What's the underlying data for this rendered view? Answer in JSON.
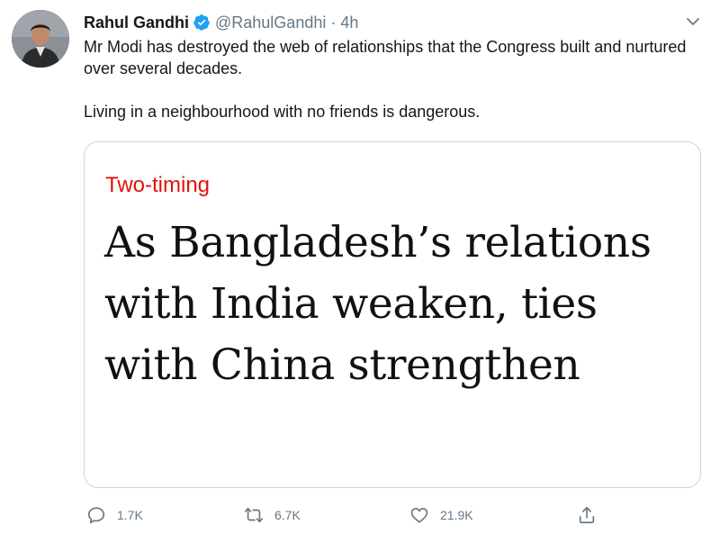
{
  "tweet": {
    "author_name": "Rahul Gandhi",
    "handle": "@RahulGandhi",
    "separator": "·",
    "time": "4h",
    "paragraph1": "Mr Modi has destroyed the web of relationships that the Congress built and nurtured over several decades.",
    "paragraph2": "Living in a neighbourhood with no friends is dangerous."
  },
  "card": {
    "kicker": "Two-timing",
    "headline": "As Bangladesh’s relations with India weaken, ties with China strengthen"
  },
  "actions": {
    "reply_count": "1.7K",
    "retweet_count": "6.7K",
    "like_count": "21.9K"
  },
  "icons": {
    "verified": "verified-badge-icon",
    "caret": "chevron-down-icon",
    "reply": "comment-icon",
    "retweet": "retweet-icon",
    "like": "heart-icon",
    "share": "share-icon"
  },
  "colors": {
    "verified_blue": "#1da1f2",
    "secondary_text": "#657786",
    "kicker_red": "#e3120b",
    "card_border": "#ccd6dd"
  }
}
